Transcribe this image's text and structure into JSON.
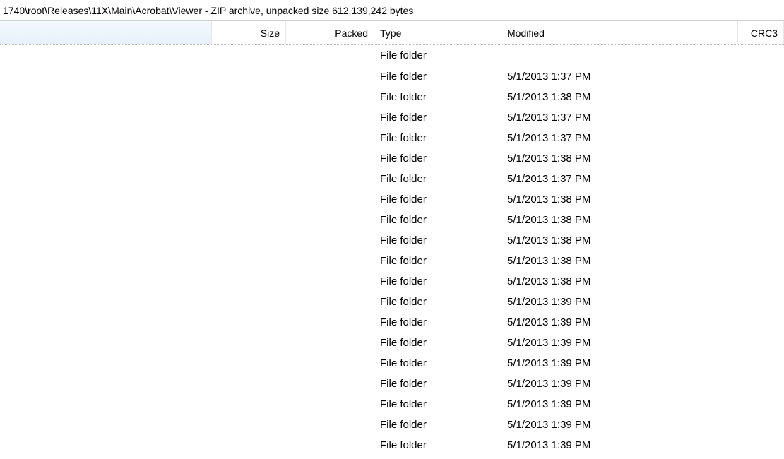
{
  "title": "1740\\root\\Releases\\11X\\Main\\Acrobat\\Viewer - ZIP archive, unpacked size 612,139,242 bytes",
  "columns": {
    "name": "",
    "size": "Size",
    "packed": "Packed",
    "type": "Type",
    "modified": "Modified",
    "crc": "CRC3"
  },
  "rows": [
    {
      "name": "",
      "size": "",
      "packed": "",
      "type": "File folder",
      "modified": "",
      "crc": ""
    },
    {
      "name": "",
      "size": "",
      "packed": "",
      "type": "File folder",
      "modified": "5/1/2013 1:37 PM",
      "crc": ""
    },
    {
      "name": "",
      "size": "",
      "packed": "",
      "type": "File folder",
      "modified": "5/1/2013 1:38 PM",
      "crc": ""
    },
    {
      "name": "",
      "size": "",
      "packed": "",
      "type": "File folder",
      "modified": "5/1/2013 1:37 PM",
      "crc": ""
    },
    {
      "name": "",
      "size": "",
      "packed": "",
      "type": "File folder",
      "modified": "5/1/2013 1:37 PM",
      "crc": ""
    },
    {
      "name": "",
      "size": "",
      "packed": "",
      "type": "File folder",
      "modified": "5/1/2013 1:38 PM",
      "crc": ""
    },
    {
      "name": "",
      "size": "",
      "packed": "",
      "type": "File folder",
      "modified": "5/1/2013 1:37 PM",
      "crc": ""
    },
    {
      "name": "",
      "size": "",
      "packed": "",
      "type": "File folder",
      "modified": "5/1/2013 1:38 PM",
      "crc": ""
    },
    {
      "name": "",
      "size": "",
      "packed": "",
      "type": "File folder",
      "modified": "5/1/2013 1:38 PM",
      "crc": ""
    },
    {
      "name": "",
      "size": "",
      "packed": "",
      "type": "File folder",
      "modified": "5/1/2013 1:38 PM",
      "crc": ""
    },
    {
      "name": "",
      "size": "",
      "packed": "",
      "type": "File folder",
      "modified": "5/1/2013 1:38 PM",
      "crc": ""
    },
    {
      "name": "",
      "size": "",
      "packed": "",
      "type": "File folder",
      "modified": "5/1/2013 1:38 PM",
      "crc": ""
    },
    {
      "name": "",
      "size": "",
      "packed": "",
      "type": "File folder",
      "modified": "5/1/2013 1:39 PM",
      "crc": ""
    },
    {
      "name": "",
      "size": "",
      "packed": "",
      "type": "File folder",
      "modified": "5/1/2013 1:39 PM",
      "crc": ""
    },
    {
      "name": "",
      "size": "",
      "packed": "",
      "type": "File folder",
      "modified": "5/1/2013 1:39 PM",
      "crc": ""
    },
    {
      "name": "",
      "size": "",
      "packed": "",
      "type": "File folder",
      "modified": "5/1/2013 1:39 PM",
      "crc": ""
    },
    {
      "name": "",
      "size": "",
      "packed": "",
      "type": "File folder",
      "modified": "5/1/2013 1:39 PM",
      "crc": ""
    },
    {
      "name": "",
      "size": "",
      "packed": "",
      "type": "File folder",
      "modified": "5/1/2013 1:39 PM",
      "crc": ""
    },
    {
      "name": "",
      "size": "",
      "packed": "",
      "type": "File folder",
      "modified": "5/1/2013 1:39 PM",
      "crc": ""
    },
    {
      "name": "",
      "size": "",
      "packed": "",
      "type": "File folder",
      "modified": "5/1/2013 1:39 PM",
      "crc": ""
    }
  ]
}
